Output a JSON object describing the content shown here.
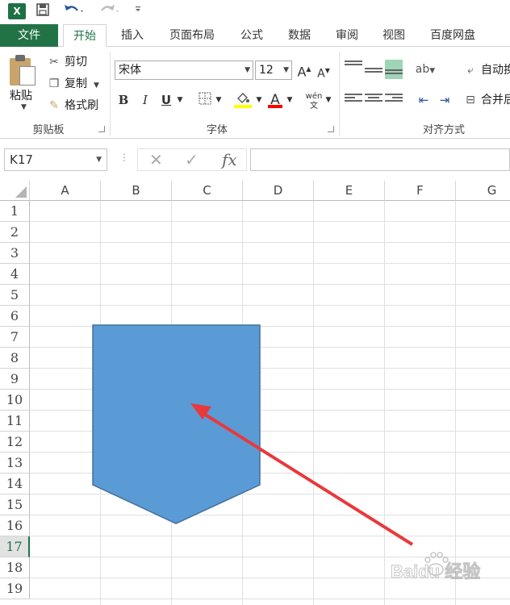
{
  "qat": {
    "app_icon": "excel-icon",
    "save_icon": "save-icon",
    "undo_icon": "undo-icon",
    "redo_icon": "redo-icon",
    "customize_icon": "customize-icon"
  },
  "tabs": [
    "文件",
    "开始",
    "插入",
    "页面布局",
    "公式",
    "数据",
    "审阅",
    "视图",
    "百度网盘"
  ],
  "active_tab_index": 1,
  "ribbon": {
    "clipboard": {
      "label": "剪贴板",
      "paste": "粘贴",
      "cut": "剪切",
      "copy": "复制",
      "format_painter": "格式刷"
    },
    "font": {
      "label": "字体",
      "font_name": "宋体",
      "font_size": "12",
      "bold": "B",
      "italic": "I",
      "underline": "U",
      "grow": "A",
      "shrink": "A",
      "font_color_letter": "A",
      "phonetic": "wén",
      "fill_color": "#ffff00",
      "text_color": "#ff0000"
    },
    "alignment": {
      "label": "对齐方式",
      "wrap_text": "自动换",
      "merge_center": "合并后",
      "selected_color": "#9fd5b7"
    }
  },
  "formula_bar": {
    "name_box": "K17",
    "cancel": "✕",
    "enter": "✓",
    "fx": "fx",
    "formula": ""
  },
  "sheet": {
    "columns": [
      "A",
      "B",
      "C",
      "D",
      "E",
      "F",
      "G"
    ],
    "rows": [
      "1",
      "2",
      "3",
      "4",
      "5",
      "6",
      "7",
      "8",
      "9",
      "10",
      "11",
      "12",
      "13",
      "14",
      "15",
      "16",
      "17",
      "18",
      "19"
    ],
    "active_row": "17",
    "shape": {
      "type": "pentagon-down-arrow",
      "fill": "#5b9bd5",
      "stroke": "#41719c"
    },
    "annotation_arrow_color": "#e8393b"
  },
  "watermark": {
    "text": "Baidu 经验"
  }
}
